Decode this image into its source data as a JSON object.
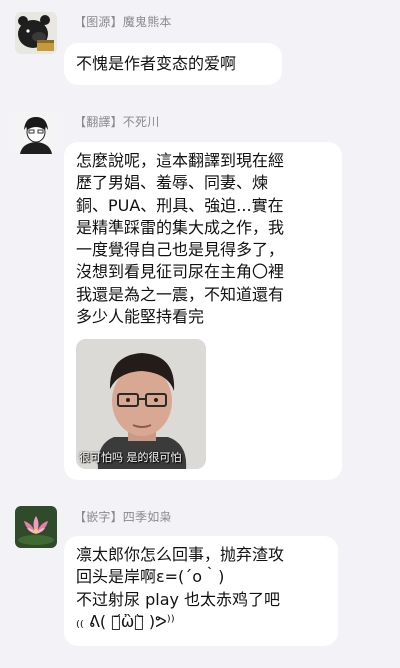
{
  "messages": [
    {
      "sender": "【图源】魔鬼熊本",
      "avatar_icon": "bear-avatar-icon",
      "lines": [
        "不愧是作者变态的爱啊"
      ]
    },
    {
      "sender": "【翻譯】不死川",
      "avatar_icon": "person-avatar-icon",
      "lines": [
        "怎麼說呢，這本翻譯到現在經",
        "歷了男娼、羞辱、同妻、煉",
        "銅、PUA、刑具、強迫...實在",
        "是精準踩雷的集大成之作，我",
        "一度覺得自己也是見得多了，",
        "沒想到看見征司尿在主角〇裡",
        "我還是為之一震，不知道還有",
        "多少人能堅持看完"
      ],
      "image_caption": "很可怕吗  是的很可怕"
    },
    {
      "sender": "【嵌字】四季如枭",
      "avatar_icon": "lotus-avatar-icon",
      "lines": [
        "凛太郎你怎么回事，抛弃渣攻",
        "回头是岸啊ε=(´ο｀)",
        "不过射尿 play 也太赤鸡了吧",
        "₍₍ ᕕ( ･᷄ὢ･᷅ )ᕗ⁾⁾"
      ]
    }
  ]
}
